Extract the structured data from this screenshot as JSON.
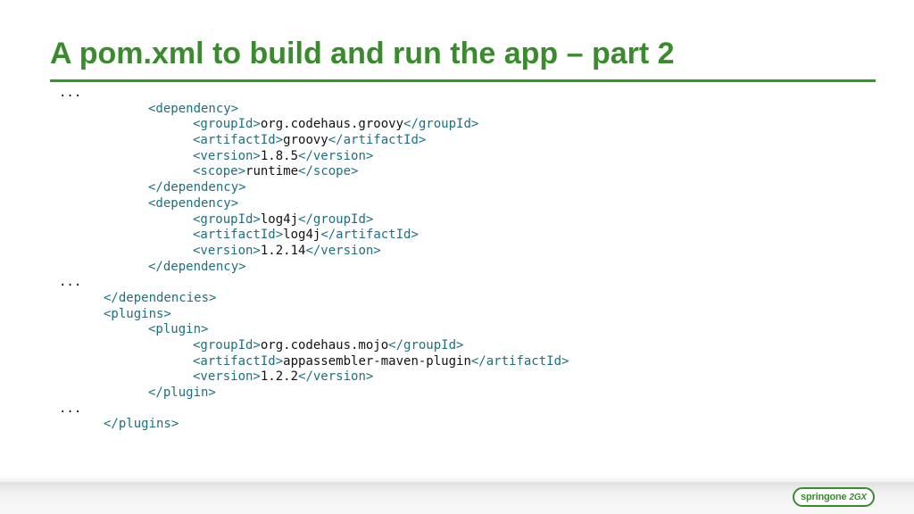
{
  "slide": {
    "title": "A pom.xml to build and run the app – part 2"
  },
  "code_lines": [
    {
      "indent": 0,
      "parts": [
        {
          "t": "e",
          "s": "..."
        }
      ]
    },
    {
      "indent": 2,
      "parts": [
        {
          "t": "g",
          "s": "<dependency>"
        }
      ]
    },
    {
      "indent": 3,
      "parts": [
        {
          "t": "g",
          "s": "<groupId>"
        },
        {
          "t": "v",
          "s": "org.codehaus.groovy"
        },
        {
          "t": "g",
          "s": "</groupId>"
        }
      ]
    },
    {
      "indent": 3,
      "parts": [
        {
          "t": "g",
          "s": "<artifactId>"
        },
        {
          "t": "v",
          "s": "groovy"
        },
        {
          "t": "g",
          "s": "</artifactId>"
        }
      ]
    },
    {
      "indent": 3,
      "parts": [
        {
          "t": "g",
          "s": "<version>"
        },
        {
          "t": "v",
          "s": "1.8.5"
        },
        {
          "t": "g",
          "s": "</version>"
        }
      ]
    },
    {
      "indent": 3,
      "parts": [
        {
          "t": "g",
          "s": "<scope>"
        },
        {
          "t": "v",
          "s": "runtime"
        },
        {
          "t": "g",
          "s": "</scope>"
        }
      ]
    },
    {
      "indent": 2,
      "parts": [
        {
          "t": "g",
          "s": "</dependency>"
        }
      ]
    },
    {
      "indent": 2,
      "parts": [
        {
          "t": "g",
          "s": "<dependency>"
        }
      ]
    },
    {
      "indent": 3,
      "parts": [
        {
          "t": "g",
          "s": "<groupId>"
        },
        {
          "t": "v",
          "s": "log4j"
        },
        {
          "t": "g",
          "s": "</groupId>"
        }
      ]
    },
    {
      "indent": 3,
      "parts": [
        {
          "t": "g",
          "s": "<artifactId>"
        },
        {
          "t": "v",
          "s": "log4j"
        },
        {
          "t": "g",
          "s": "</artifactId>"
        }
      ]
    },
    {
      "indent": 3,
      "parts": [
        {
          "t": "g",
          "s": "<version>"
        },
        {
          "t": "v",
          "s": "1.2.14"
        },
        {
          "t": "g",
          "s": "</version>"
        }
      ]
    },
    {
      "indent": 2,
      "parts": [
        {
          "t": "g",
          "s": "</dependency>"
        }
      ]
    },
    {
      "indent": 0,
      "parts": [
        {
          "t": "e",
          "s": "..."
        }
      ]
    },
    {
      "indent": 1,
      "parts": [
        {
          "t": "g",
          "s": "</dependencies>"
        }
      ]
    },
    {
      "indent": 1,
      "parts": [
        {
          "t": "g",
          "s": "<plugins>"
        }
      ]
    },
    {
      "indent": 2,
      "parts": [
        {
          "t": "g",
          "s": "<plugin>"
        }
      ]
    },
    {
      "indent": 3,
      "parts": [
        {
          "t": "g",
          "s": "<groupId>"
        },
        {
          "t": "v",
          "s": "org.codehaus.mojo"
        },
        {
          "t": "g",
          "s": "</groupId>"
        }
      ]
    },
    {
      "indent": 3,
      "parts": [
        {
          "t": "g",
          "s": "<artifactId>"
        },
        {
          "t": "v",
          "s": "appassembler-maven-plugin"
        },
        {
          "t": "g",
          "s": "</artifactId>"
        }
      ]
    },
    {
      "indent": 3,
      "parts": [
        {
          "t": "g",
          "s": "<version>"
        },
        {
          "t": "v",
          "s": "1.2.2"
        },
        {
          "t": "g",
          "s": "</version>"
        }
      ]
    },
    {
      "indent": 2,
      "parts": [
        {
          "t": "g",
          "s": "</plugin>"
        }
      ]
    },
    {
      "indent": 0,
      "parts": [
        {
          "t": "e",
          "s": "..."
        }
      ]
    },
    {
      "indent": 1,
      "parts": [
        {
          "t": "g",
          "s": "</plugins>"
        }
      ]
    }
  ],
  "footer": {
    "logo_text": "springone",
    "logo_suffix": "2GX"
  },
  "colors": {
    "title": "#3a8a2e",
    "rule": "#2f9a2a",
    "tag": "#1d6f80",
    "value": "#111111"
  }
}
